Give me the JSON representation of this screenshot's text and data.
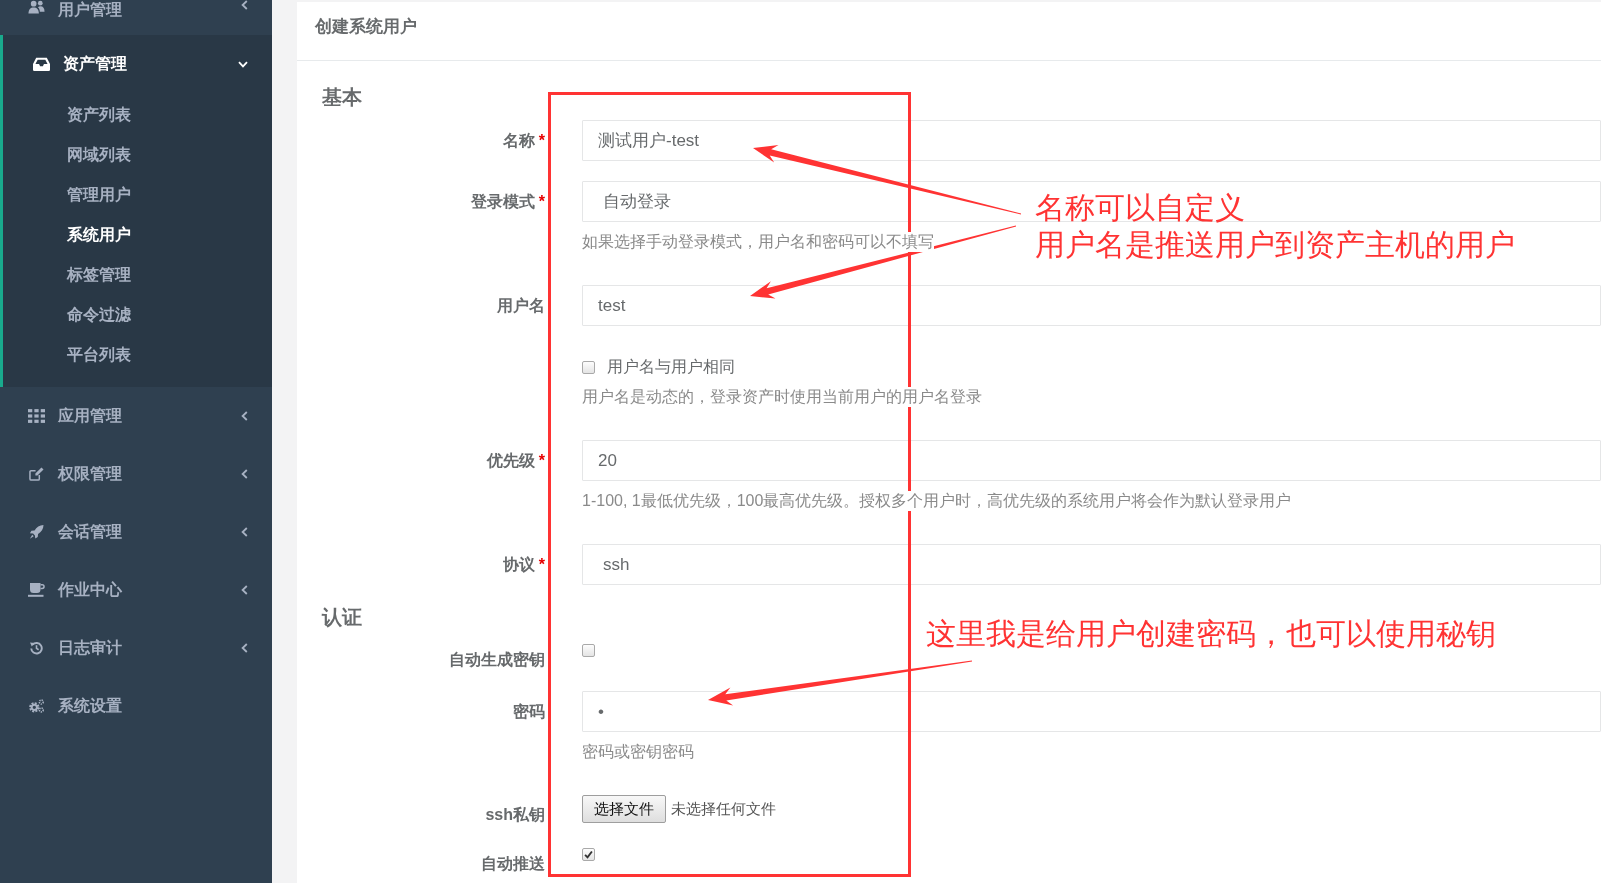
{
  "sidebar": {
    "items": [
      {
        "label": "用户管理",
        "expanded": false
      },
      {
        "label": "资产管理",
        "expanded": true,
        "children": [
          {
            "label": "资产列表",
            "selected": false
          },
          {
            "label": "网域列表",
            "selected": false
          },
          {
            "label": "管理用户",
            "selected": false
          },
          {
            "label": "系统用户",
            "selected": true
          },
          {
            "label": "标签管理",
            "selected": false
          },
          {
            "label": "命令过滤",
            "selected": false
          },
          {
            "label": "平台列表",
            "selected": false
          }
        ]
      },
      {
        "label": "应用管理",
        "expanded": false
      },
      {
        "label": "权限管理",
        "expanded": false
      },
      {
        "label": "会话管理",
        "expanded": false
      },
      {
        "label": "作业中心",
        "expanded": false
      },
      {
        "label": "日志审计",
        "expanded": false
      },
      {
        "label": "系统设置"
      }
    ]
  },
  "panel": {
    "title": "创建系统用户",
    "sections": [
      {
        "heading": "基本",
        "fields": [
          {
            "kind": "text",
            "label": "名称",
            "required_mark": "*",
            "value": "测试用户-test"
          },
          {
            "kind": "select",
            "label": "登录模式",
            "required_mark": "*",
            "value": "自动登录",
            "help": "如果选择手动登录模式，用户名和密码可以不填写"
          },
          {
            "kind": "text",
            "label": "用户名",
            "value": "test"
          },
          {
            "kind": "checkbox",
            "option": "用户名与用户相同",
            "checked": false,
            "help": "用户名是动态的，登录资产时使用当前用户的用户名登录"
          },
          {
            "kind": "text",
            "label": "优先级",
            "required_mark": "*",
            "value": "20",
            "help": "1-100, 1最低优先级，100最高优先级。授权多个用户时，高优先级的系统用户将会作为默认登录用户"
          },
          {
            "kind": "select",
            "label": "协议",
            "required_mark": "*",
            "value": "ssh"
          }
        ]
      },
      {
        "heading": "认证",
        "fields": [
          {
            "kind": "checkbox",
            "label": "自动生成密钥",
            "checked": false
          },
          {
            "kind": "text",
            "label": "密码",
            "value": "•",
            "help": "密码或密钥密码"
          },
          {
            "kind": "file",
            "label": "ssh私钥",
            "button": "选择文件",
            "status": "未选择任何文件"
          },
          {
            "kind": "checkbox",
            "label": "自动推送",
            "checked": true
          }
        ]
      }
    ]
  },
  "annotations": [
    {
      "text": "名称可以自定义"
    },
    {
      "text": "用户名是推送用户到资产主机的用户"
    },
    {
      "text": "这里我是给用户创建密码，也可以使用秘钥"
    }
  ]
}
